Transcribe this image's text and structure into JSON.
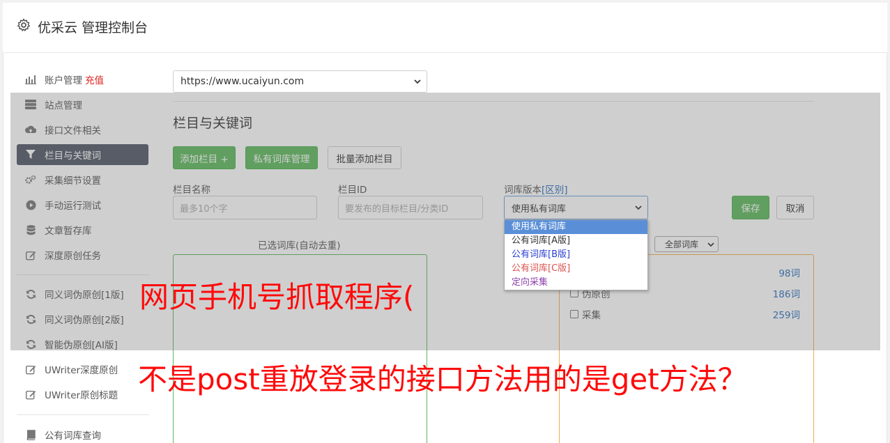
{
  "header": {
    "title": "优采云 管理控制台",
    "icon": "gear-icon"
  },
  "sidebar": {
    "items": [
      {
        "label": "账户管理",
        "icon": "bar-chart-icon",
        "badge": "充值"
      },
      {
        "label": "站点管理",
        "icon": "server-icon"
      },
      {
        "label": "接口文件相关",
        "icon": "cloud-upload-icon"
      },
      {
        "label": "栏目与关键词",
        "icon": "filter-icon",
        "active": true
      },
      {
        "label": "采集细节设置",
        "icon": "cogs-icon"
      },
      {
        "label": "手动运行测试",
        "icon": "play-circle-icon"
      },
      {
        "label": "文章暂存库",
        "icon": "database-icon"
      },
      {
        "label": "深度原创任务",
        "icon": "edit-icon"
      },
      {
        "label": "同义词伪原创[1版]",
        "icon": "refresh-icon"
      },
      {
        "label": "同义词伪原创[2版]",
        "icon": "refresh-icon"
      },
      {
        "label": "智能伪原创[AI版]",
        "icon": "refresh-icon"
      },
      {
        "label": "UWriter深度原创",
        "icon": "edit-icon"
      },
      {
        "label": "UWriter原创标题",
        "icon": "edit-icon"
      },
      {
        "label": "公有词库查询",
        "icon": "book-icon"
      }
    ]
  },
  "site_select": {
    "value": "https://www.ucaiyun.com"
  },
  "section": {
    "title": "栏目与关键词"
  },
  "toolbar": {
    "add_column": "添加栏目 +",
    "private_lib": "私有词库管理",
    "batch_add": "批量添加栏目"
  },
  "form": {
    "column_name_label": "栏目名称",
    "column_name_placeholder": "最多10个字",
    "column_id_label": "栏目ID",
    "column_id_placeholder": "要发布的目标栏目/分类ID",
    "lib_version_label": "词库版本",
    "lib_version_link": "[区别]",
    "lib_version_value": "使用私有词库",
    "save": "保存",
    "cancel": "取消"
  },
  "dropdown": {
    "options": [
      {
        "label": "使用私有词库",
        "color": "#ffffff",
        "selected": true
      },
      {
        "label": "公有词库[A版]",
        "color": "#333333"
      },
      {
        "label": "公有词库[B版]",
        "color": "#2b3fcf"
      },
      {
        "label": "公有词库[C版]",
        "color": "#d9534f"
      },
      {
        "label": "定向采集",
        "color": "#8e44ad"
      }
    ]
  },
  "left_panel": {
    "title": "已选词库(自动去重)"
  },
  "right_panel": {
    "filter_value": "全部词库",
    "rows": [
      {
        "label": "",
        "count": "98词"
      },
      {
        "label": "伪原创",
        "count": "186词"
      },
      {
        "label": "采集",
        "count": "259词"
      }
    ]
  },
  "overlay_text": {
    "line1": "网页手机号抓取程序(",
    "line2": "不是post重放登录的接口方法用的是get方法？"
  },
  "colors": {
    "accent_green": "#5cb85c",
    "active_nav": "#4e5665",
    "overlay_red": "#ff0a0a"
  }
}
